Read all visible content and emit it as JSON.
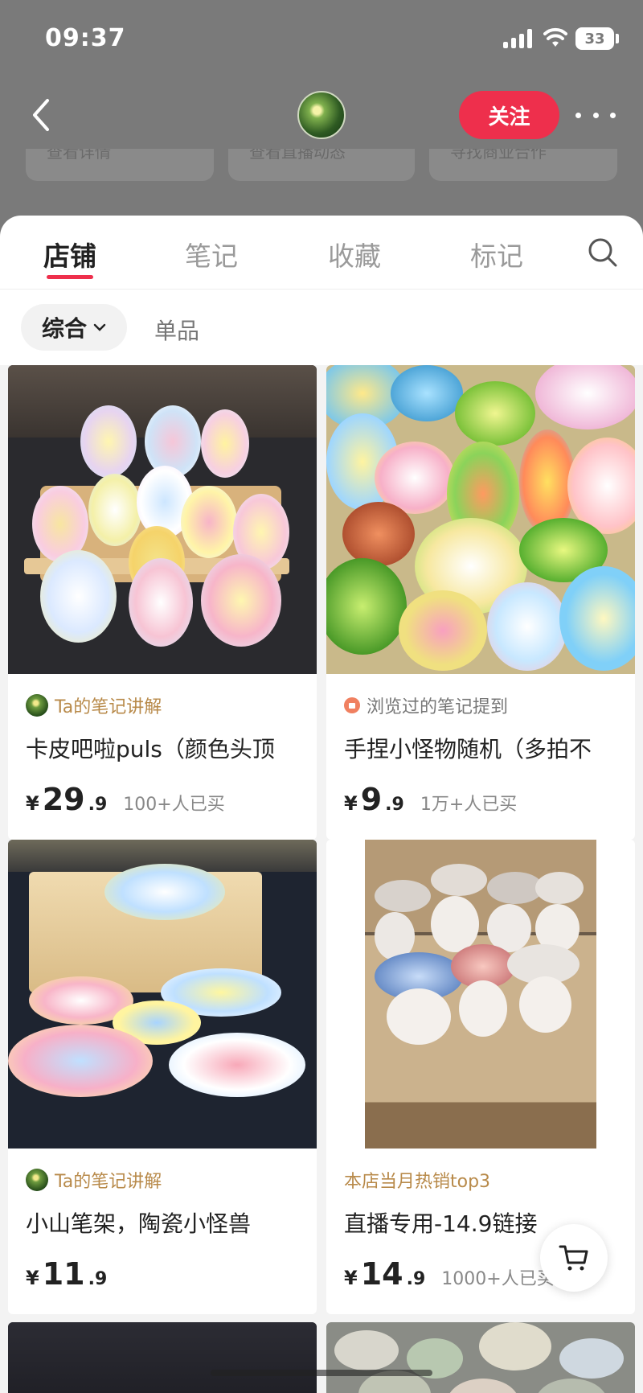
{
  "status_bar": {
    "time": "09:37",
    "battery": "33"
  },
  "nav": {
    "follow_label": "关注"
  },
  "chips": [
    "查看详情",
    "查看直播动态",
    "寻找商业合作"
  ],
  "tabs": [
    {
      "label": "店铺",
      "active": true
    },
    {
      "label": "笔记",
      "active": false
    },
    {
      "label": "收藏",
      "active": false
    },
    {
      "label": "标记",
      "active": false
    }
  ],
  "filters": {
    "sort_label": "综合",
    "single_label": "单品"
  },
  "products": [
    {
      "tag": "Ta的笔记讲解",
      "tag_style": "gold",
      "title": "卡皮吧啦puls（颜色头顶",
      "currency": "¥",
      "price_int": "29",
      "price_dec": ".9",
      "sold": "100+人已买"
    },
    {
      "tag": "浏览过的笔记提到",
      "tag_style": "gray",
      "title": "手捏小怪物随机（多拍不",
      "currency": "¥",
      "price_int": "9",
      "price_dec": ".9",
      "sold": "1万+人已买"
    },
    {
      "tag": "Ta的笔记讲解",
      "tag_style": "gold",
      "title": "小山笔架，陶瓷小怪兽",
      "currency": "¥",
      "price_int": "11",
      "price_dec": ".9",
      "sold": ""
    },
    {
      "tag": "本店当月热销top3",
      "tag_style": "gold",
      "title": "直播专用-14.9链接",
      "currency": "¥",
      "price_int": "14",
      "price_dec": ".9",
      "sold": "1000+人已买"
    }
  ],
  "colors": {
    "accent": "#ee2f4c",
    "tag_gold": "#b88a4a"
  }
}
